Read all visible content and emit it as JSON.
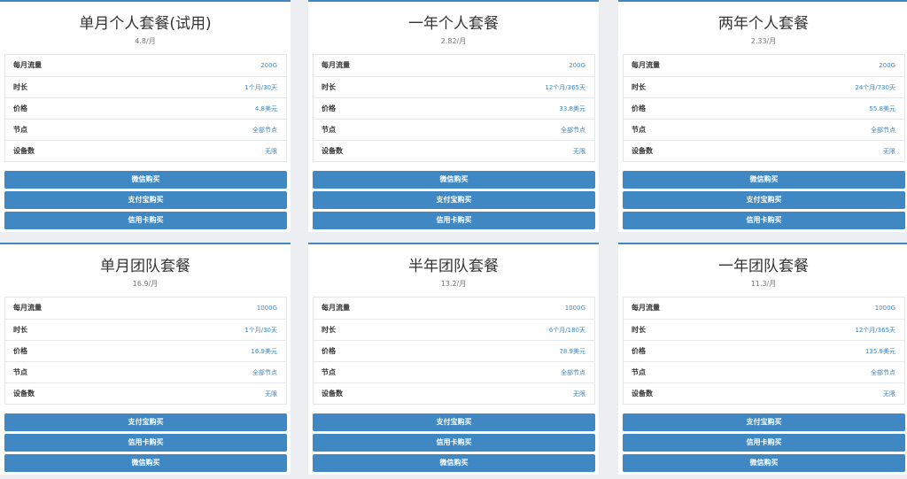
{
  "accent_color": "#3f88c3",
  "plans": [
    {
      "title": "单月个人套餐(试用)",
      "subtitle": "4.8/月",
      "specs": [
        {
          "label": "每月流量",
          "value": "200G"
        },
        {
          "label": "时长",
          "value": "1个月/30天"
        },
        {
          "label": "价格",
          "value": "4.8美元"
        },
        {
          "label": "节点",
          "value": "全部节点"
        },
        {
          "label": "设备数",
          "value": "无限"
        }
      ],
      "buttons": [
        "微信购买",
        "支付宝购买",
        "信用卡购买"
      ]
    },
    {
      "title": "一年个人套餐",
      "subtitle": "2.82/月",
      "specs": [
        {
          "label": "每月流量",
          "value": "200G"
        },
        {
          "label": "时长",
          "value": "12个月/365天"
        },
        {
          "label": "价格",
          "value": "33.8美元"
        },
        {
          "label": "节点",
          "value": "全部节点"
        },
        {
          "label": "设备数",
          "value": "无限"
        }
      ],
      "buttons": [
        "微信购买",
        "支付宝购买",
        "信用卡购买"
      ]
    },
    {
      "title": "两年个人套餐",
      "subtitle": "2.33/月",
      "specs": [
        {
          "label": "每月流量",
          "value": "200G"
        },
        {
          "label": "时长",
          "value": "24个月/730天"
        },
        {
          "label": "价格",
          "value": "55.8美元"
        },
        {
          "label": "节点",
          "value": "全部节点"
        },
        {
          "label": "设备数",
          "value": "无限"
        }
      ],
      "buttons": [
        "微信购买",
        "支付宝购买",
        "信用卡购买"
      ]
    },
    {
      "title": "单月团队套餐",
      "subtitle": "16.9/月",
      "specs": [
        {
          "label": "每月流量",
          "value": "1000G"
        },
        {
          "label": "时长",
          "value": "1个月/30天"
        },
        {
          "label": "价格",
          "value": "16.9美元"
        },
        {
          "label": "节点",
          "value": "全部节点"
        },
        {
          "label": "设备数",
          "value": "无限"
        }
      ],
      "buttons": [
        "支付宝购买",
        "信用卡购买",
        "微信购买"
      ]
    },
    {
      "title": "半年团队套餐",
      "subtitle": "13.2/月",
      "specs": [
        {
          "label": "每月流量",
          "value": "1000G"
        },
        {
          "label": "时长",
          "value": "6个月/180天"
        },
        {
          "label": "价格",
          "value": "78.9美元"
        },
        {
          "label": "节点",
          "value": "全部节点"
        },
        {
          "label": "设备数",
          "value": "无限"
        }
      ],
      "buttons": [
        "支付宝购买",
        "信用卡购买",
        "微信购买"
      ]
    },
    {
      "title": "一年团队套餐",
      "subtitle": "11.3/月",
      "specs": [
        {
          "label": "每月流量",
          "value": "1000G"
        },
        {
          "label": "时长",
          "value": "12个月/365天"
        },
        {
          "label": "价格",
          "value": "135.9美元"
        },
        {
          "label": "节点",
          "value": "全部节点"
        },
        {
          "label": "设备数",
          "value": "无限"
        }
      ],
      "buttons": [
        "支付宝购买",
        "信用卡购买",
        "微信购买"
      ]
    }
  ]
}
